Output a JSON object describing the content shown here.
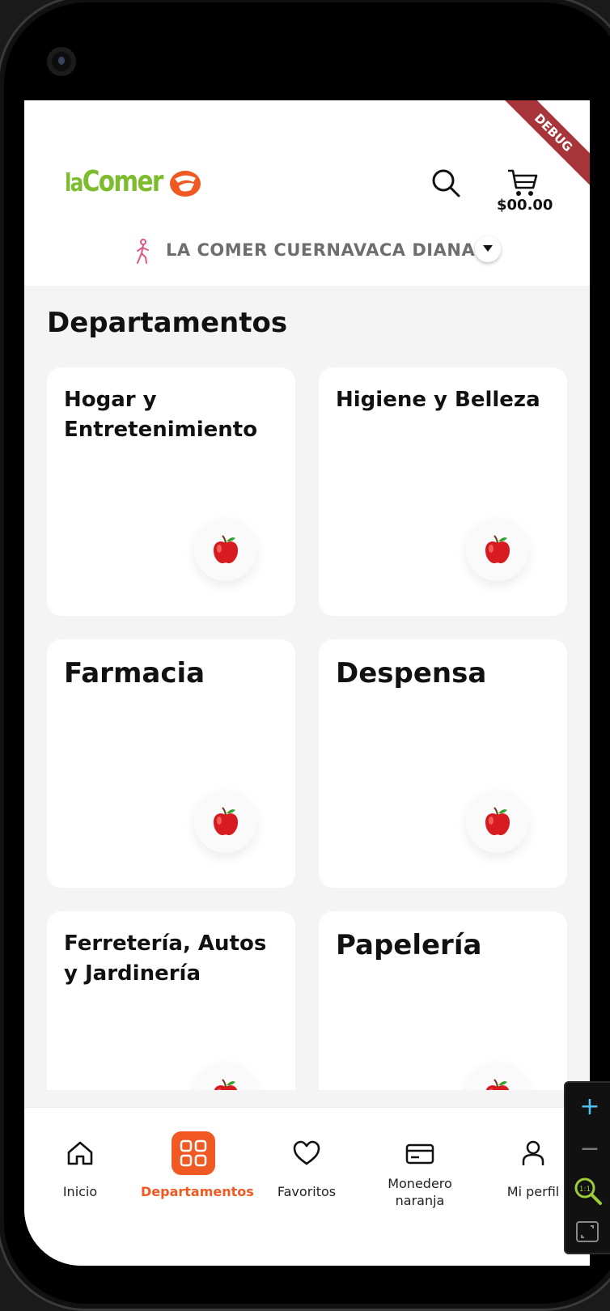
{
  "header": {
    "logo_text_la": "la",
    "logo_text_comer": "Comer",
    "cart_total": "$00.00",
    "debug_banner": "DEBUG",
    "store_name": "LA COMER CUERNAVACA DIANA"
  },
  "main": {
    "section_title": "Departamentos",
    "departments": [
      {
        "label": "Hogar y Entretenimiento",
        "icon": "apple-icon"
      },
      {
        "label": "Higiene y Belleza",
        "icon": "apple-icon"
      },
      {
        "label": "Farmacia",
        "icon": "apple-icon"
      },
      {
        "label": "Despensa",
        "icon": "apple-icon"
      },
      {
        "label": "Ferretería, Autos y Jardinería",
        "icon": "apple-icon"
      },
      {
        "label": "Papelería",
        "icon": "apple-icon"
      }
    ]
  },
  "bottom_nav": {
    "active": "Departamentos",
    "accent_color": "#f05a22",
    "items": [
      {
        "label": "Inicio",
        "icon": "home-icon"
      },
      {
        "label": "Departamentos",
        "icon": "grid-icon"
      },
      {
        "label": "Favoritos",
        "icon": "heart-icon"
      },
      {
        "label": "Monedero naranja",
        "icon": "card-icon"
      },
      {
        "label": "Mi perfil",
        "icon": "user-icon"
      }
    ]
  },
  "zoom_controls": {
    "zoom_in": "+",
    "zoom_out": "−",
    "reset_label": "1:1"
  },
  "colors": {
    "brand_green": "#7dbb2f",
    "brand_orange": "#f05a22",
    "debug_red": "#a8353a",
    "background": "#f4f4f4"
  }
}
